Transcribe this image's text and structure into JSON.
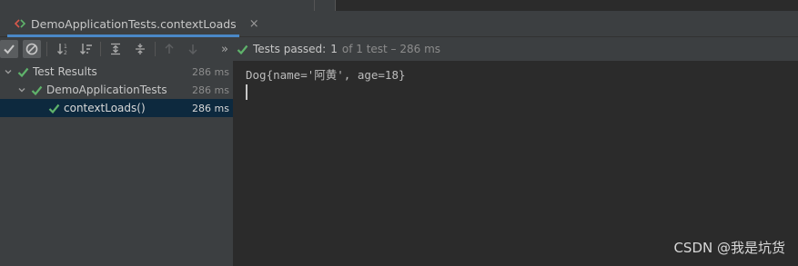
{
  "tab": {
    "title": "DemoApplicationTests.contextLoads",
    "close": "×"
  },
  "toolbar": {
    "buttons": [
      "show-passed",
      "show-ignored",
      "sort-alphabetically",
      "sort-by-duration",
      "expand-all",
      "collapse-all",
      "previous-failed",
      "next-failed",
      "more"
    ],
    "more_label": "»",
    "status": {
      "prefix": "Tests passed:",
      "count": "1",
      "suffix": "of 1 test – 286 ms"
    }
  },
  "tree": [
    {
      "label": "Test Results",
      "time": "286 ms",
      "level": 0,
      "selected": false
    },
    {
      "label": "DemoApplicationTests",
      "time": "286 ms",
      "level": 1,
      "selected": false
    },
    {
      "label": "contextLoads()",
      "time": "286 ms",
      "level": 2,
      "selected": true
    }
  ],
  "console": {
    "output": "Dog{name='阿黄', age=18}"
  },
  "watermark": "CSDN @我是坑货",
  "colors": {
    "pass_green": "#5fb36b",
    "accent_blue": "#4a88c7",
    "selection": "#0d293e"
  }
}
